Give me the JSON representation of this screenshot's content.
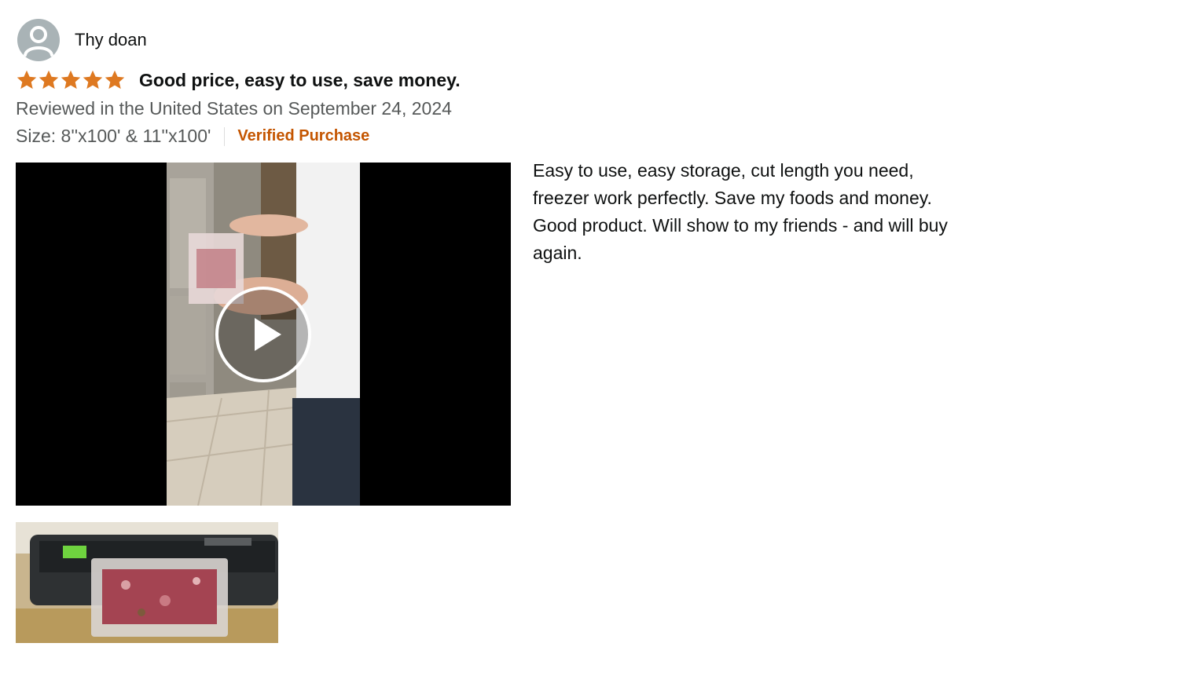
{
  "review": {
    "reviewer_name": "Thy doan",
    "rating": 5,
    "rating_max": 5,
    "title": "Good price, easy to use, save money.",
    "date_line": "Reviewed in the United States on September 24, 2024",
    "size_line": "Size: 8''x100' & 11''x100'",
    "verified_label": "Verified Purchase",
    "body": "Easy to use, easy storage, cut length you need, freezer work perfectly. Save my foods and money. Good product. Will show to my friends - and will buy again."
  },
  "icons": {
    "avatar": "user-silhouette-icon",
    "star": "star-icon",
    "play": "play-icon"
  },
  "colors": {
    "star": "#de7921",
    "verified": "#c45500",
    "secondary_text": "#565959",
    "primary_text": "#0f1111",
    "avatar_bg": "#a9b3b6"
  }
}
